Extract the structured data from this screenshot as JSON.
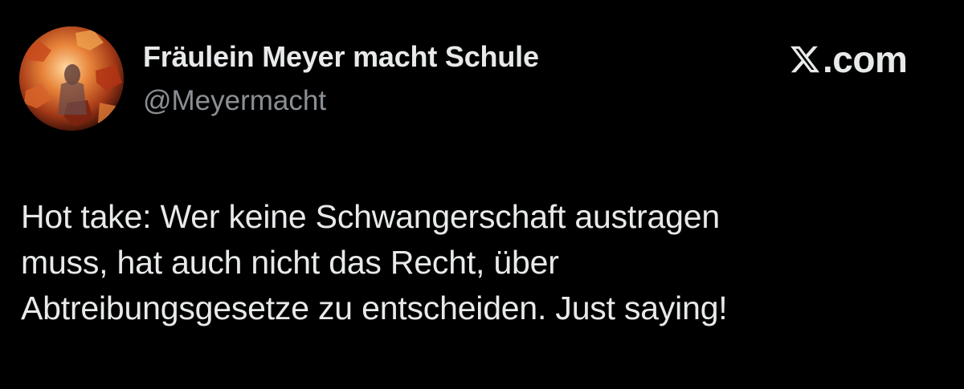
{
  "author": {
    "display_name": "Fräulein Meyer macht Schule",
    "handle": "@Meyermacht",
    "avatar_icon": "autumn-leaves-portrait-avatar"
  },
  "brand": {
    "logo_icon": "x-logo-icon",
    "text": ".com"
  },
  "tweet": {
    "lines": [
      "Hot take: Wer keine Schwangerschaft austragen",
      "muss, hat auch nicht das Recht, über",
      "Abtreibungsgesetze zu entscheiden. Just saying!"
    ]
  },
  "colors": {
    "background": "#000000",
    "primary_text": "#e7e9ea",
    "secondary_text": "#8b8f94"
  }
}
